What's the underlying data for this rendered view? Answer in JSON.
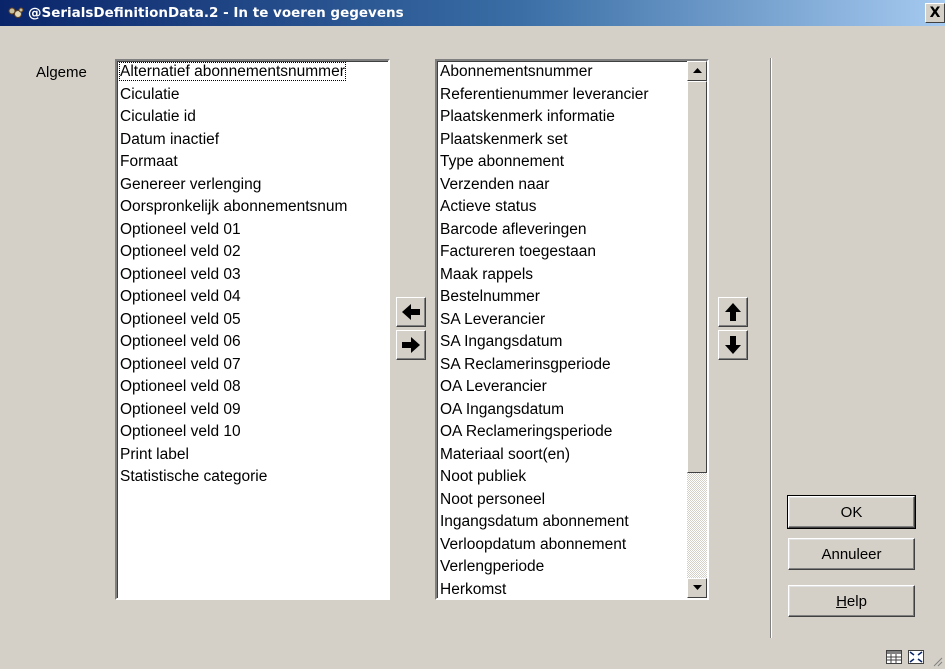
{
  "window": {
    "title": "@SerialsDefinitionData.2 - In te voeren gegevens",
    "close_symbol": "X"
  },
  "left_label": "Algeme",
  "available_fields": [
    "Alternatief abonnementsnummer",
    "Ciculatie",
    "Ciculatie id",
    "Datum inactief",
    "Formaat",
    "Genereer verlenging",
    "Oorspronkelijk abonnementsnum",
    "Optioneel veld 01",
    "Optioneel veld 02",
    "Optioneel veld 03",
    "Optioneel veld 04",
    "Optioneel veld 05",
    "Optioneel veld 06",
    "Optioneel veld 07",
    "Optioneel veld 08",
    "Optioneel veld 09",
    "Optioneel veld 10",
    "Print label",
    "Statistische categorie"
  ],
  "selected_fields": [
    "Abonnementsnummer",
    "Referentienummer leverancier",
    "Plaatskenmerk informatie",
    "Plaatskenmerk set",
    "Type abonnement",
    "Verzenden naar",
    "Actieve status",
    "Barcode afleveringen",
    "Factureren toegestaan",
    "Maak rappels",
    "Bestelnummer",
    "SA Leverancier",
    "SA Ingangsdatum",
    "SA Reclamerinsgperiode",
    "OA Leverancier",
    "OA Ingangsdatum",
    "OA Reclameringsperiode",
    "Materiaal soort(en)",
    "Noot publiek",
    "Noot personeel",
    "Ingangsdatum abonnement",
    "Verloopdatum abonnement",
    "Verlengperiode",
    "Herkomst"
  ],
  "buttons": {
    "ok": "OK",
    "cancel": "Annuleer",
    "help_first": "H",
    "help_rest": "elp"
  },
  "icons": {
    "move_left": "arrow-left-icon",
    "move_right": "arrow-right-icon",
    "move_up": "arrow-up-icon",
    "move_down": "arrow-down-icon"
  },
  "colors": {
    "titlebar_start": "#0a246a",
    "titlebar_end": "#a6caf0",
    "face": "#d4d0c8"
  }
}
